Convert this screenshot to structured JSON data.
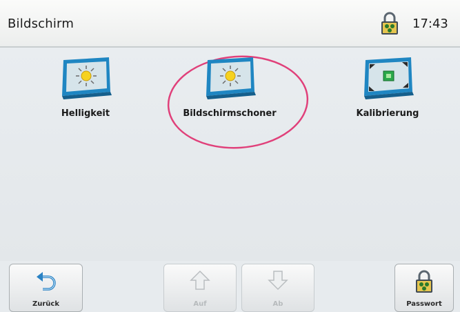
{
  "header": {
    "title": "Bildschirm",
    "time": "17:43"
  },
  "tiles": [
    {
      "label": "Helligkeit",
      "icon": "brightness-monitor-icon"
    },
    {
      "label": "Bildschirmschoner",
      "icon": "screensaver-monitor-icon"
    },
    {
      "label": "Kalibrierung",
      "icon": "calibration-monitor-icon"
    }
  ],
  "buttons": {
    "back": "Zurück",
    "up": "Auf",
    "down": "Ab",
    "password": "Passwort"
  },
  "colors": {
    "highlight_ellipse": "#e0407a",
    "screen_blue": "#1f86c2",
    "lock_gold": "#d8b341"
  }
}
